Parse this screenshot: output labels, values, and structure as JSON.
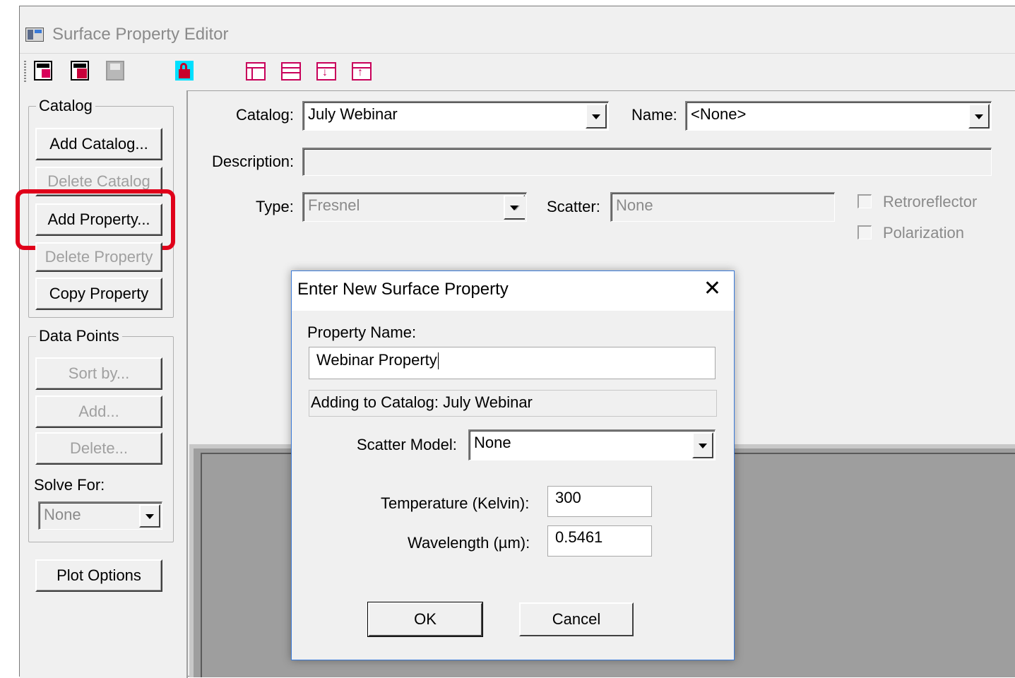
{
  "window": {
    "title": "Surface Property Editor"
  },
  "toolbar": {
    "icons": [
      "open-catalog-icon",
      "import-catalog-icon",
      "save-icon",
      "lock-icon",
      "layout-1-icon",
      "layout-2-icon",
      "layout-3-icon",
      "layout-4-icon"
    ]
  },
  "catalog_group": {
    "label": "Catalog",
    "add_catalog": "Add Catalog...",
    "delete_catalog": "Delete Catalog",
    "add_property": "Add Property...",
    "delete_property": "Delete Property",
    "copy_property": "Copy Property"
  },
  "data_points_group": {
    "label": "Data Points",
    "sort_by": "Sort by...",
    "add": "Add...",
    "delete": "Delete...",
    "solve_for_label": "Solve For:",
    "solve_for_value": "None"
  },
  "plot_options": "Plot Options",
  "form": {
    "catalog_label": "Catalog:",
    "catalog_value": "July Webinar",
    "name_label": "Name:",
    "name_value": "<None>",
    "description_label": "Description:",
    "description_value": "",
    "type_label": "Type:",
    "type_value": "Fresnel",
    "scatter_label": "Scatter:",
    "scatter_value": "None",
    "retroreflector_label": "Retroreflector",
    "polarization_label": "Polarization"
  },
  "dialog": {
    "title": "Enter New Surface Property",
    "close_glyph": "✕",
    "property_name_label": "Property Name:",
    "property_name_value": "Webinar Property",
    "adding_to": "Adding to Catalog: July Webinar",
    "scatter_model_label": "Scatter Model:",
    "scatter_model_value": "None",
    "temperature_label": "Temperature (Kelvin):",
    "temperature_value": "300",
    "wavelength_label": "Wavelength (µm):",
    "wavelength_value": "0.5461",
    "ok": "OK",
    "cancel": "Cancel"
  },
  "colors": {
    "highlight": "#e0001a",
    "dialog_border": "#3a7ad8"
  }
}
